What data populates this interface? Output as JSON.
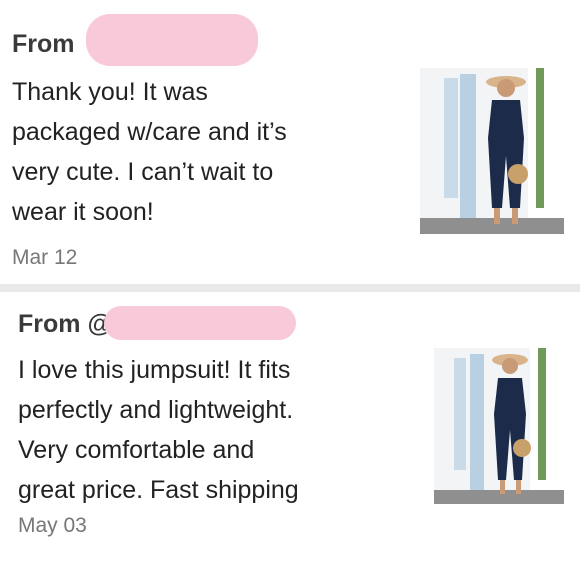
{
  "reviews": [
    {
      "from_label": "From",
      "body_lines": [
        "Thank you! It was",
        "packaged w/care and it’s",
        "very cute. I can’t wait to",
        "wear it soon!"
      ],
      "date": "Mar 12",
      "image_icon": "product-photo-jumpsuit"
    },
    {
      "from_label": "From @",
      "body_lines": [
        "I love this jumpsuit! It fits",
        "perfectly and lightweight.",
        "Very comfortable and",
        "great price. Fast shipping"
      ],
      "date": "May 03",
      "image_icon": "product-photo-jumpsuit"
    }
  ],
  "colors": {
    "redaction": "#f8c9d8",
    "separator": "#e9e9e9",
    "jumpsuit": "#1c2b4a"
  }
}
